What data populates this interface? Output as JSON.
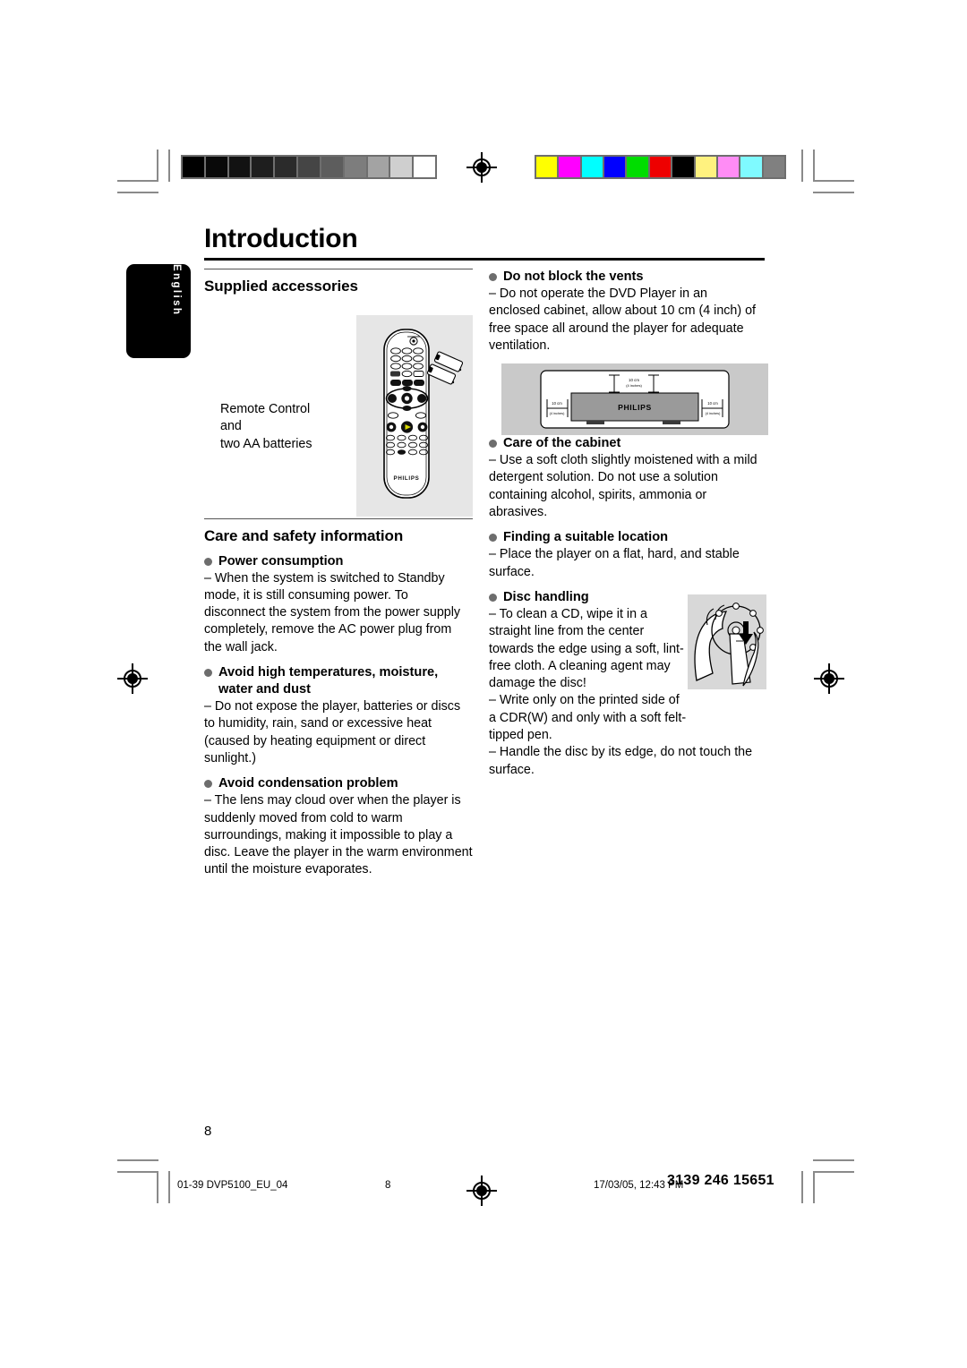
{
  "document": {
    "chapter_title": "Introduction",
    "language_tab": "English",
    "folio": "8"
  },
  "calibration": {
    "grayscale_label": "grayscale-calibration-bar",
    "grayscale_swatches": [
      "#000000",
      "#090909",
      "#121212",
      "#1e1e1e",
      "#2b2b2b",
      "#454545",
      "#5d5d5d",
      "#7d7d7d",
      "#a3a3a3",
      "#cfcfcf",
      "#ffffff"
    ],
    "color_label": "color-calibration-bar",
    "color_swatches": [
      "#ffff00",
      "#ff00ff",
      "#00ffff",
      "#0000ff",
      "#00dd00",
      "#ee0000",
      "#000000",
      "#fff27f",
      "#ff8cf5",
      "#7ffaff",
      "#808080"
    ]
  },
  "left_column": {
    "section_accessories": "Supplied accessories",
    "accessories_caption_lines": [
      "Remote Control",
      "and",
      "two AA batteries"
    ],
    "remote_figure": {
      "brand": "PHILIPS",
      "keypad_digits": [
        "1",
        "2",
        "3",
        "4",
        "5",
        "6",
        "7",
        "8",
        "9",
        "0"
      ]
    },
    "section_care": "Care and safety information",
    "items": [
      {
        "heading": "Power consumption",
        "body": "– When the system is switched to Standby mode, it is still consuming power. To disconnect the system from the power supply completely, remove the AC power plug from the wall jack."
      },
      {
        "heading": "Avoid high temperatures, moisture, water and dust",
        "body": "– Do not expose the player, batteries or discs to humidity, rain, sand or excessive heat (caused by heating equipment or direct sunlight.)"
      },
      {
        "heading": "Avoid condensation problem",
        "body": "– The lens may cloud over when the player is suddenly moved from cold to warm surroundings, making it impossible to play a disc. Leave the player in the warm environment until the moisture evaporates."
      }
    ]
  },
  "right_column": {
    "items": [
      {
        "heading": "Do not block the vents",
        "body": "– Do not operate the DVD Player in an enclosed cabinet, allow about 10 cm (4 inch) of free space all around the player for adequate ventilation."
      },
      {
        "heading": "Care of the cabinet",
        "body": "– Use a soft cloth slightly moistened with a mild detergent solution. Do not use a solution containing alcohol, spirits, ammonia or abrasives."
      },
      {
        "heading": "Finding a suitable location",
        "body": "– Place the player on a flat, hard, and stable surface."
      },
      {
        "heading": "Disc handling",
        "body_1": "– To clean a CD, wipe it in a straight line from the center towards the edge using a soft, lint-free cloth. A cleaning agent may damage the disc!",
        "body_2": "– Write only on the printed side of a CDR(W) and only with a soft felt-tipped pen.",
        "body_3": "– Handle the disc by its edge, do not touch the surface."
      }
    ],
    "vent_figure": {
      "brand": "PHILIPS",
      "clearance_top": "10 cm (4 inches)",
      "clearance_left": "10 cm (4 inches)",
      "clearance_right": "10 cm (4 inches)"
    }
  },
  "footer": {
    "file_slug": "01-39 DVP5100_EU_04",
    "page_slug": "8",
    "date_slug": "17/03/05, 12:43 PM",
    "code_slug": "3139 246 15651"
  }
}
